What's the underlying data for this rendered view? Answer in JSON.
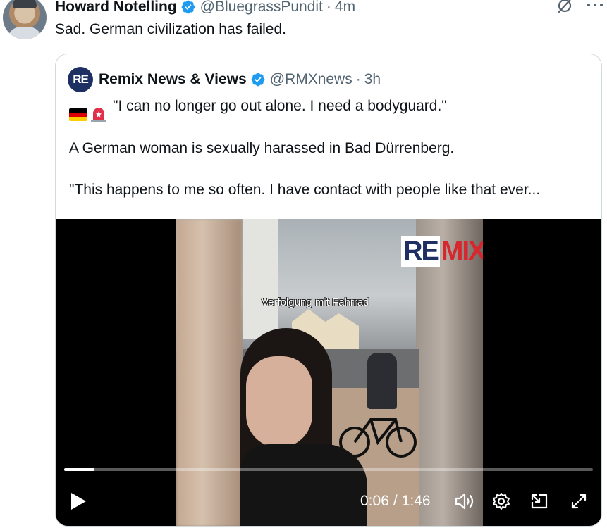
{
  "tweet": {
    "author_name": "Howard Notelling",
    "handle": "@BluegrassPundit",
    "separator": "·",
    "time": "4m",
    "text": "Sad. German civilization has failed."
  },
  "quoted": {
    "avatar_text": "RE",
    "author_name": "Remix News & Views",
    "handle": "@RMXnews",
    "separator": "·",
    "time": "3h",
    "line1": "\"I can no longer go out alone. I need a bodyguard.\"",
    "line2": "A German woman is sexually harassed in Bad Dürrenberg.",
    "line3": "\"This happens to me so often. I have contact with people like that ever...",
    "emoji_icons": [
      "germany-flag-icon",
      "siren-icon"
    ]
  },
  "video": {
    "watermark_re": "RE",
    "watermark_mix": "MIX",
    "caption": "Verfolgung mit Fahrrad",
    "current_time": "0:06",
    "time_separator": "/",
    "duration": "1:46",
    "progress_fraction": 0.057,
    "controls": [
      "play-icon",
      "volume-icon",
      "settings-icon",
      "picture-in-picture-icon",
      "fullscreen-icon"
    ]
  },
  "colors": {
    "verified_blue": "#1d9bf0",
    "secondary_text": "#536471",
    "remix_navy": "#1d2f63",
    "remix_red": "#d7262e"
  }
}
